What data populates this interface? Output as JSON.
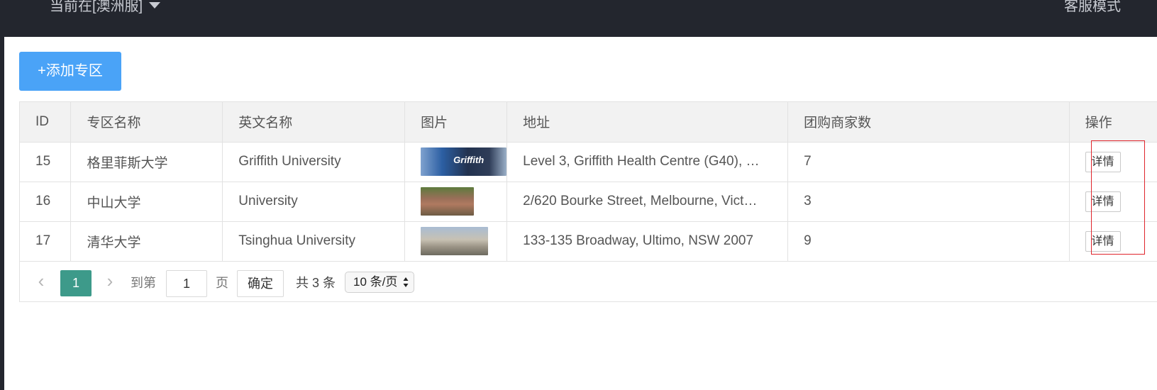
{
  "header": {
    "region_label": "当前在[澳洲服]",
    "service_mode": "客服模式"
  },
  "toolbar": {
    "add_label": "+添加专区"
  },
  "table": {
    "columns": [
      "ID",
      "专区名称",
      "英文名称",
      "图片",
      "地址",
      "团购商家数",
      "操作"
    ],
    "rows": [
      {
        "id": "15",
        "name": "格里菲斯大学",
        "en_name": "Griffith University",
        "image": "griffith-campus-photo",
        "image_text": "Griffith",
        "address": "Level 3, Griffith Health Centre (G40), …",
        "merchants": "7",
        "action": "详情"
      },
      {
        "id": "16",
        "name": "中山大学",
        "en_name": "University",
        "image": "zhongshan-campus-photo",
        "address": "2/620 Bourke Street, Melbourne, Vict…",
        "merchants": "3",
        "action": "详情"
      },
      {
        "id": "17",
        "name": "清华大学",
        "en_name": "Tsinghua University",
        "image": "tsinghua-campus-photo",
        "address": "133-135 Broadway, Ultimo, NSW 2007",
        "merchants": "9",
        "action": "详情"
      }
    ]
  },
  "pagination": {
    "current_page": "1",
    "goto_prefix": "到第",
    "goto_value": "1",
    "goto_suffix": "页",
    "confirm_label": "确定",
    "total_text": "共 3 条",
    "page_size": "10 条/页"
  }
}
